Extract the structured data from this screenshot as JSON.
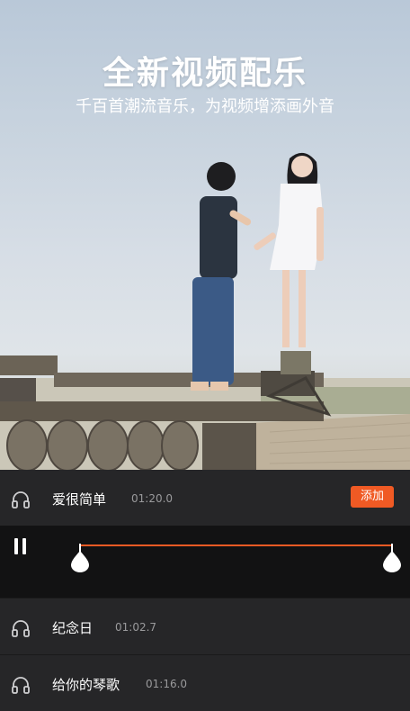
{
  "hero": {
    "title": "全新视频配乐",
    "subtitle": "千百首潮流音乐，为视频增添画外音"
  },
  "songs": [
    {
      "title": "爱很简单",
      "duration": "01:20.0",
      "icon": "headphones-icon",
      "action_label": "添加"
    },
    {
      "title": "纪念日",
      "duration": "01:02.7",
      "icon": "headphones-icon"
    },
    {
      "title": "给你的琴歌",
      "duration": "01:16.0",
      "icon": "headphones-icon"
    }
  ],
  "player": {
    "state_icon": "pause-icon",
    "trim_start_fraction": 0.0,
    "trim_end_fraction": 1.0
  },
  "colors": {
    "accent": "#f05a24",
    "list_bg": "#262628",
    "player_bg": "#121213"
  }
}
